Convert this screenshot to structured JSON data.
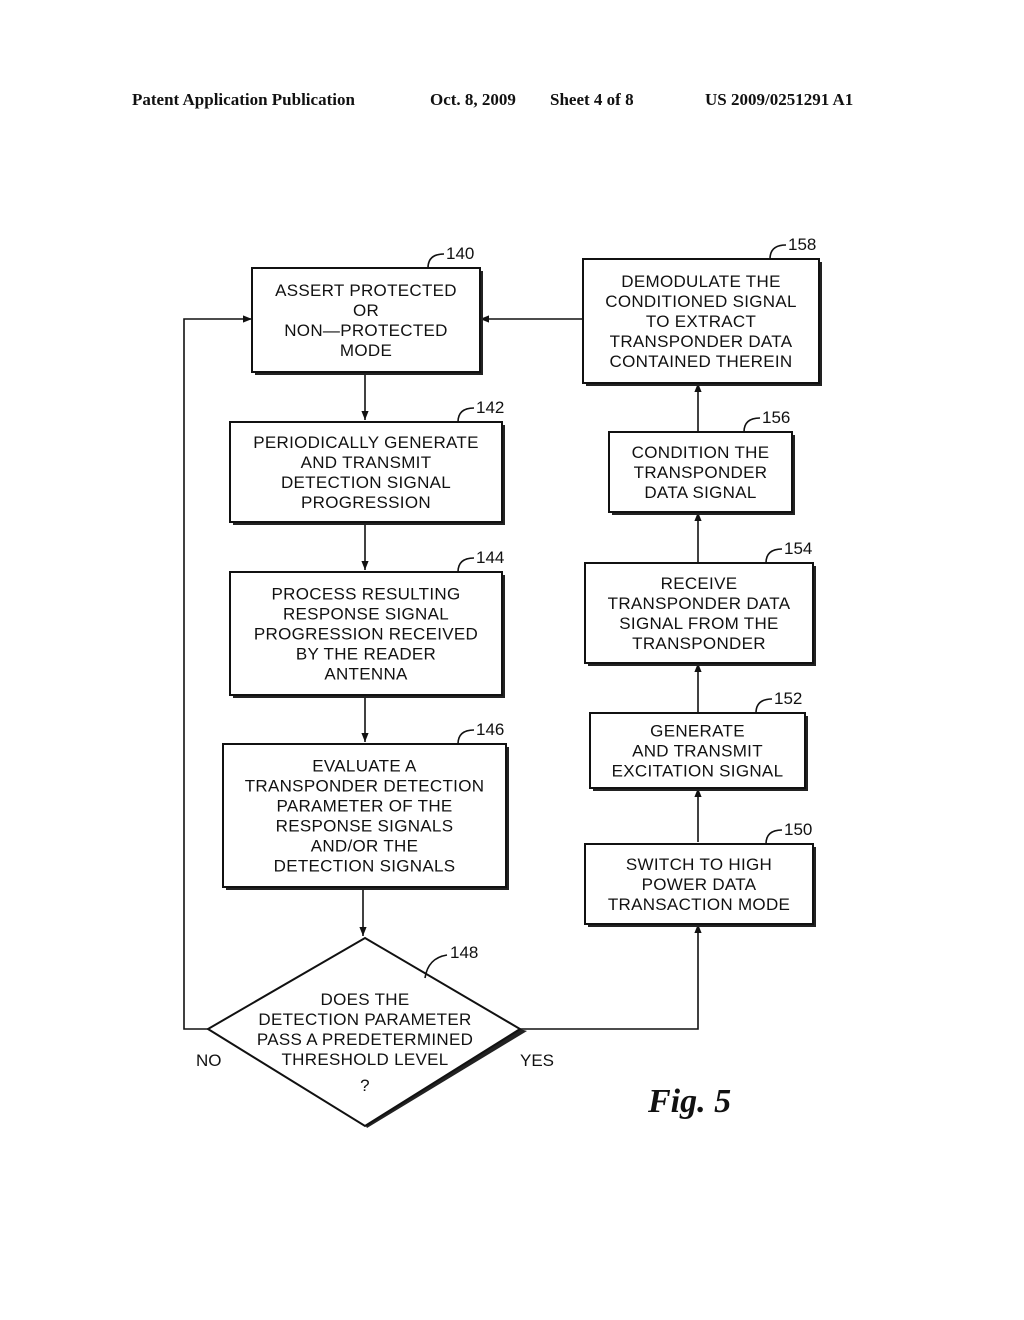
{
  "header": {
    "publication": "Patent Application Publication",
    "date": "Oct. 8, 2009",
    "sheet": "Sheet 4 of 8",
    "number": "US 2009/0251291 A1"
  },
  "figure_label": "Fig. 5",
  "steps": {
    "s140": {
      "ref": "140",
      "lines": [
        "ASSERT  PROTECTED",
        "OR",
        "NON—PROTECTED",
        "MODE"
      ]
    },
    "s142": {
      "ref": "142",
      "lines": [
        "PERIODICALLY  GENERATE",
        "AND  TRANSMIT",
        "DETECTION  SIGNAL",
        "PROGRESSION"
      ]
    },
    "s144": {
      "ref": "144",
      "lines": [
        "PROCESS  RESULTING",
        "RESPONSE  SIGNAL",
        "PROGRESSION  RECEIVED",
        "BY  THE  READER",
        "ANTENNA"
      ]
    },
    "s146": {
      "ref": "146",
      "lines": [
        "EVALUATE  A",
        "TRANSPONDER  DETECTION",
        "PARAMETER  OF  THE",
        "RESPONSE  SIGNALS",
        "AND/OR  THE",
        "DETECTION  SIGNALS"
      ]
    },
    "s148": {
      "ref": "148",
      "lines": [
        "DOES  THE",
        "DETECTION  PARAMETER",
        "PASS  A  PREDETERMINED",
        "THRESHOLD  LEVEL",
        "?"
      ]
    },
    "s150": {
      "ref": "150",
      "lines": [
        "SWITCH  TO  HIGH",
        "POWER  DATA",
        "TRANSACTION  MODE"
      ]
    },
    "s152": {
      "ref": "152",
      "lines": [
        "GENERATE",
        "AND  TRANSMIT",
        "EXCITATION  SIGNAL"
      ]
    },
    "s154": {
      "ref": "154",
      "lines": [
        "RECEIVE",
        "TRANSPONDER  DATA",
        "SIGNAL  FROM  THE",
        "TRANSPONDER"
      ]
    },
    "s156": {
      "ref": "156",
      "lines": [
        "CONDITION  THE",
        "TRANSPONDER",
        "DATA  SIGNAL"
      ]
    },
    "s158": {
      "ref": "158",
      "lines": [
        "DEMODULATE  THE",
        "CONDITIONED  SIGNAL",
        "TO  EXTRACT",
        "TRANSPONDER  DATA",
        "CONTAINED  THEREIN"
      ]
    }
  },
  "branches": {
    "no": "NO",
    "yes": "YES"
  }
}
